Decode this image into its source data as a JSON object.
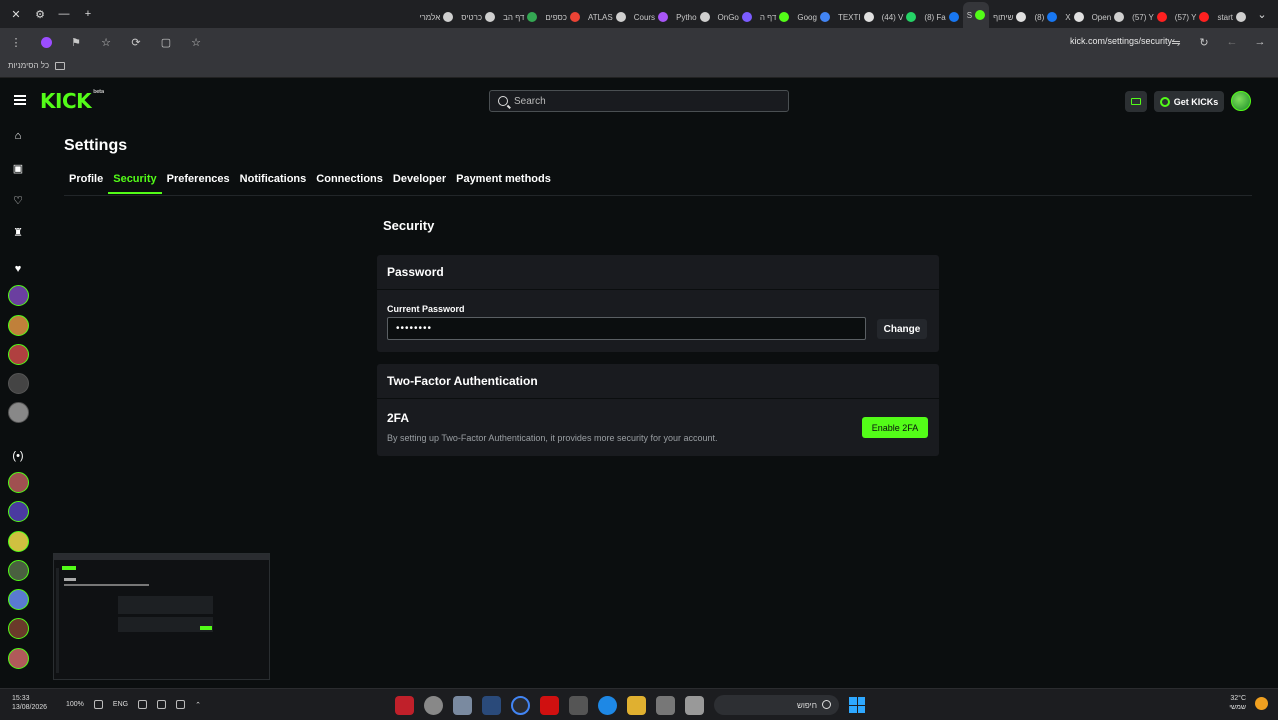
{
  "browser": {
    "tabs": [
      {
        "label": "start",
        "color": "#cfcfcf"
      },
      {
        "label": "(57) Y",
        "color": "#ff2020"
      },
      {
        "label": "(57) Y",
        "color": "#ff2020"
      },
      {
        "label": "Open",
        "color": "#cfcfcf"
      },
      {
        "label": "X",
        "color": "#e0e0e0"
      },
      {
        "label": "(8)",
        "color": "#1877f2"
      },
      {
        "label": "שיתוף",
        "color": "#e0e0e0"
      },
      {
        "label": "S",
        "color": "#53fc18",
        "active": true
      },
      {
        "label": "(8) Fa",
        "color": "#1877f2"
      },
      {
        "label": "(44) V",
        "color": "#25d366"
      },
      {
        "label": "TEXTI",
        "color": "#e0e0e0"
      },
      {
        "label": "Goog",
        "color": "#4285f4"
      },
      {
        "label": "דף ה",
        "color": "#53fc18"
      },
      {
        "label": "OnGo",
        "color": "#7b5cff"
      },
      {
        "label": "Pytho",
        "color": "#cfcfcf"
      },
      {
        "label": "Cours",
        "color": "#a855f7"
      },
      {
        "label": "ATLAS",
        "color": "#cfcfcf"
      },
      {
        "label": "כספים",
        "color": "#ea4335"
      },
      {
        "label": "דף הב",
        "color": "#34a853"
      },
      {
        "label": "כרטיס",
        "color": "#cfcfcf"
      },
      {
        "label": "אלמרי",
        "color": "#cfcfcf"
      }
    ],
    "url": "kick.com/settings/security",
    "bookmarks_folder": "כל הסימניות"
  },
  "header": {
    "logo": "KICK",
    "logo_badge": "beta",
    "search_placeholder": "Search",
    "get_kicks_label": "Get KICKs"
  },
  "settings": {
    "title": "Settings",
    "tabs": [
      "Profile",
      "Security",
      "Preferences",
      "Notifications",
      "Connections",
      "Developer",
      "Payment methods"
    ],
    "active_tab": "Security",
    "section_title": "Security",
    "password": {
      "card_title": "Password",
      "field_label": "Current Password",
      "field_value": "••••••••",
      "change_label": "Change"
    },
    "two_factor": {
      "card_title": "Two-Factor Authentication",
      "title": "2FA",
      "description": "By setting up Two-Factor Authentication, it provides more security for your account.",
      "enable_label": "Enable 2FA"
    }
  },
  "colors": {
    "accent": "#53fc18",
    "background": "#0b0e0f",
    "card": "#191b1f"
  },
  "taskbar": {
    "time": "15:33",
    "date": "13/08/2026",
    "battery": "100%",
    "language": "ENG",
    "search_label": "חיפוש",
    "temperature": "32°C",
    "weather": "שמשי"
  }
}
